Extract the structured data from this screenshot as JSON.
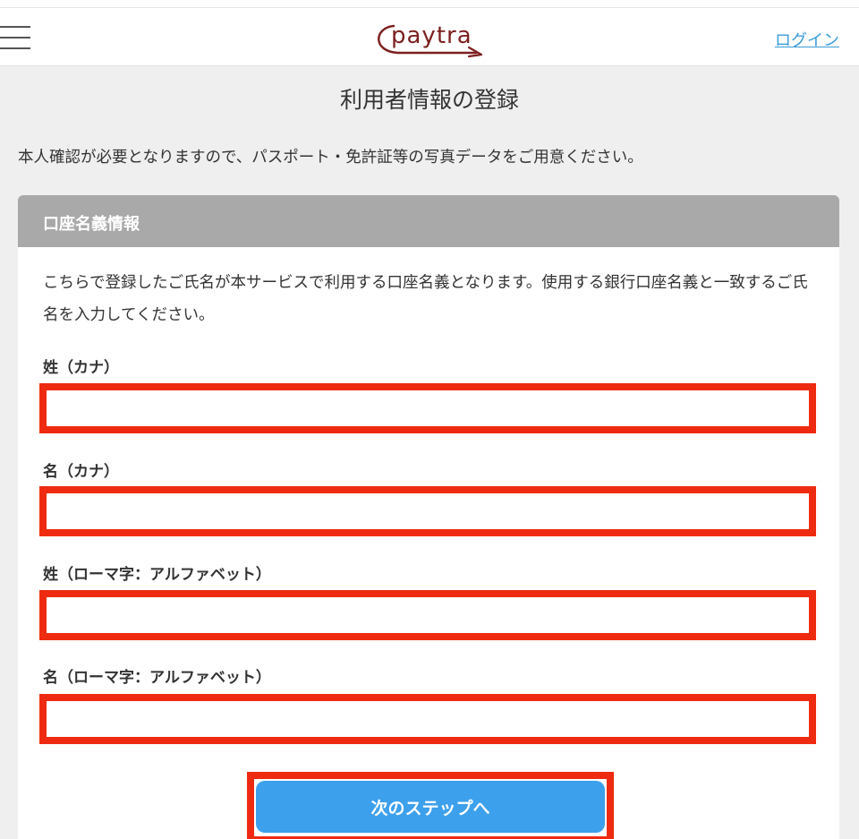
{
  "header": {
    "logo_text": "paytra",
    "login_label": "ログイン"
  },
  "page": {
    "title": "利用者情報の登録",
    "notice": "本人確認が必要となりますので、パスポート・免許証等の写真データをご用意ください。"
  },
  "card": {
    "title": "口座名義情報",
    "description": "こちらで登録したご氏名が本サービスで利用する口座名義となります。使用する銀行口座名義と一致するご氏名を入力してください。",
    "fields": [
      {
        "label": "姓（カナ）",
        "value": "",
        "placeholder": ""
      },
      {
        "label": "名（カナ）",
        "value": "",
        "placeholder": ""
      },
      {
        "label": "姓（ローマ字：アルファベット）",
        "value": "",
        "placeholder": ""
      },
      {
        "label": "名（ローマ字：アルファベット）",
        "value": "",
        "placeholder": ""
      }
    ],
    "next_button_label": "次のステップへ"
  },
  "colors": {
    "brand": "#7d1f1f",
    "link": "#3a9bd9",
    "button": "#3da0ec",
    "highlight": "#ee2b10",
    "card_header": "#a9a9a9"
  }
}
